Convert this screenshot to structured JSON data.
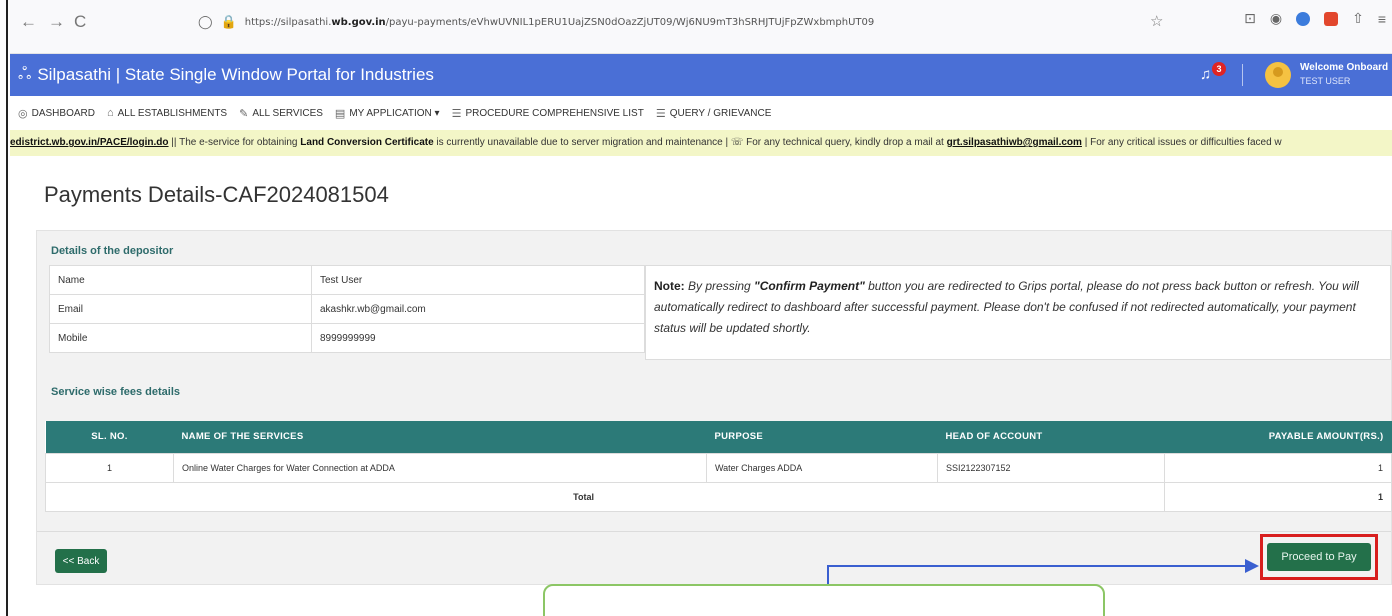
{
  "browser": {
    "back": "←",
    "forward": "→",
    "reload": "C",
    "shield": "◯",
    "lock": "🔒",
    "url_prefix": "https://silpasathi.",
    "url_domain": "wb.gov.in",
    "url_path": "/payu-payments/eVhwUVNIL1pERU1UajZSN0dOazZjUT09/Wj6NU9mT3hSRHJTUjFpZWxbmphUT09",
    "star": "☆"
  },
  "header": {
    "logo": "ஃ",
    "title": "Silpasathi | State Single Window Portal for Industries",
    "notification_count": "3",
    "welcome": "Welcome Onboard",
    "user": "TEST USER"
  },
  "nav": {
    "items": [
      {
        "icon": "◎",
        "label": "DASHBOARD"
      },
      {
        "icon": "⌂",
        "label": "ALL ESTABLISHMENTS"
      },
      {
        "icon": "✎",
        "label": "ALL SERVICES"
      },
      {
        "icon": "▤",
        "label": "MY APPLICATION ▾"
      },
      {
        "icon": "☰",
        "label": "PROCEDURE COMPREHENSIVE LIST"
      },
      {
        "icon": "☰",
        "label": "QUERY / GRIEVANCE"
      }
    ]
  },
  "notice": {
    "link": "edistrict.wb.gov.in/PACE/login.do",
    "text1": " || The e-service for obtaining ",
    "bold1": "Land Conversion Certificate",
    "text2": " is currently unavailable due to server migration and maintenance | ☏ For any technical query, kindly drop a mail at ",
    "email": "grt.silpasathiwb@gmail.com",
    "text3": " | For any critical issues or difficulties faced w"
  },
  "page": {
    "title": "Payments Details-CAF2024081504"
  },
  "depositor": {
    "section_title": "Details of the depositor",
    "rows": [
      {
        "label": "Name",
        "value": "Test User"
      },
      {
        "label": "Email",
        "value": "akashkr.wb@gmail.com"
      },
      {
        "label": "Mobile",
        "value": "8999999999"
      }
    ],
    "note_label": "Note:",
    "note_pre": " By pressing ",
    "note_bold": "\"Confirm Payment\"",
    "note_post": " button you are redirected to Grips portal, please do not press back button or refresh. You will automatically redirect to dashboard after successful payment. Please don't be confused if not redirected automatically, your payment status will be updated shortly."
  },
  "fees": {
    "section_title": "Service wise fees details",
    "headers": [
      "SL. NO.",
      "NAME OF THE SERVICES",
      "PURPOSE",
      "HEAD OF ACCOUNT",
      "PAYABLE AMOUNT(RS.)"
    ],
    "rows": [
      {
        "sl": "1",
        "service": "Online Water Charges for Water Connection at ADDA",
        "purpose": "Water Charges ADDA",
        "head": "SSI2122307152",
        "amount": "1"
      }
    ],
    "total_label": "Total",
    "total_value": "1"
  },
  "actions": {
    "back": "<< Back",
    "proceed": "Proceed to Pay"
  },
  "colors": {
    "header_bg": "#4a6fd6",
    "table_header": "#2c7a78",
    "button_green": "#23704a",
    "highlight_red": "#d81e1e"
  }
}
